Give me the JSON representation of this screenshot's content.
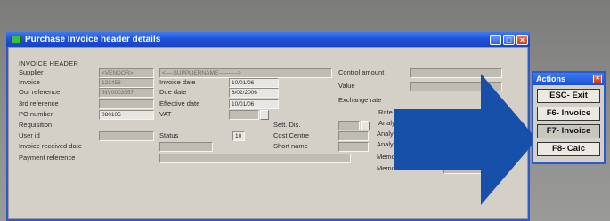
{
  "window": {
    "title": "Purchase Invoice header details",
    "section_title": "INVOICE HEADER"
  },
  "left": {
    "supplier_label": "Supplier",
    "supplier_code": "<VENDOR>",
    "supplier_name": "<----SUPPLIERNAME---------->",
    "invoice_label": "Invoice",
    "invoice_value": "123456",
    "our_ref_label": "Our reference",
    "our_ref_value": "INV0003557",
    "third_ref_label": "3rd reference",
    "po_label": "PO number",
    "po_value": "080105",
    "requisition_label": "Requisition",
    "user_label": "User id",
    "inv_received_label": "Invoice received date",
    "payment_ref_label": "Payment reference"
  },
  "middle": {
    "invoice_date_label": "Invoice date",
    "invoice_date_value": "10/01/06",
    "due_date_label": "Due date",
    "due_date_value": "8/02/2006",
    "effective_date_label": "Effective date",
    "effective_date_value": "10/01/06",
    "vat_label": "VAT",
    "status_label": "Status",
    "status_value": "10",
    "sett_disc_label": "Sett. Dis.",
    "cost_centre_label": "Cost Centre",
    "short_name_label": "Short name"
  },
  "right": {
    "control_amount_label": "Control amount",
    "value_label": "Value",
    "exchange_rate_label": "Exchange rate",
    "rate_label": "Rate",
    "analysis_a_label": "Analy",
    "analysis_b_label": "Analys",
    "analysis_c_label": "Analysis C",
    "memo1_label": "Memo 1",
    "memo2_label": "Memo 2"
  },
  "actions": {
    "title": "Actions",
    "buttons": [
      "ESC- Exit",
      "F6- Invoice",
      "F7- Invoice",
      "F8- Calc"
    ]
  },
  "colors": {
    "titlebar": "#1c4fd6",
    "arrow": "#1650a8",
    "dialog_bg": "#d4d0c8"
  }
}
